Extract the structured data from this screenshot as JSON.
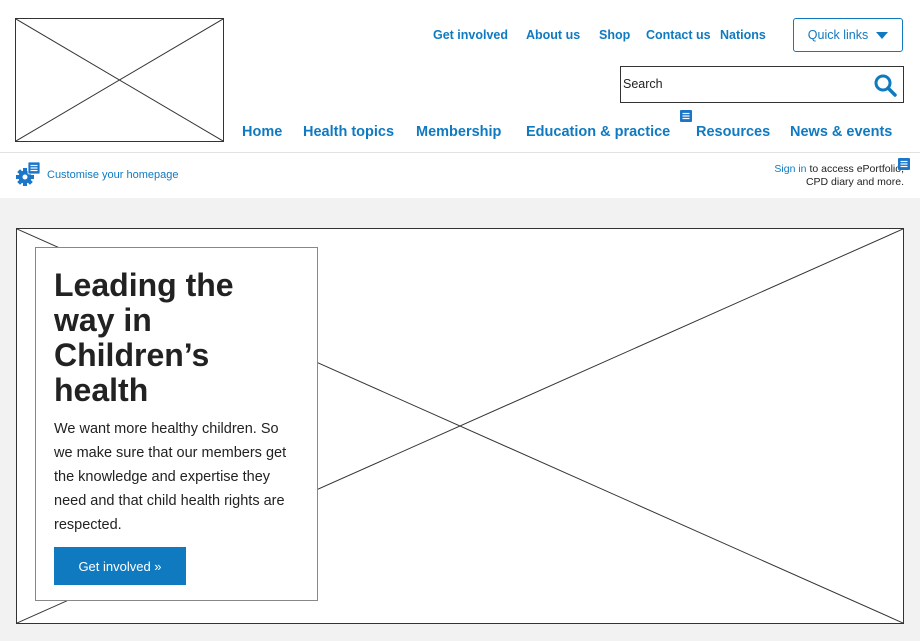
{
  "header": {
    "utility_links": [
      "Get involved",
      "About us",
      "Shop",
      "Contact us",
      "Nations"
    ],
    "quick_links": {
      "label": "Quick links"
    },
    "search": {
      "placeholder": "Search"
    },
    "main_nav": [
      "Home",
      "Health topics",
      "Membership",
      "Education & practice",
      "Resources",
      "News & events"
    ]
  },
  "subbar": {
    "customise": "Customise your homepage",
    "sign_in_link": "Sign in",
    "sign_in_line1": " to access ePortfolio,",
    "sign_in_line2": "CPD diary and more."
  },
  "hero": {
    "title": "Leading the way in Children’s health",
    "body": "We want more healthy children. So we make sure that our members get the knowledge and expertise they need and that child health rights are respected.",
    "button": "Get involved »"
  },
  "colors": {
    "link": "#0f7ac0",
    "button_bg": "#0f7ac0",
    "band_bg": "#f2f2f2"
  }
}
